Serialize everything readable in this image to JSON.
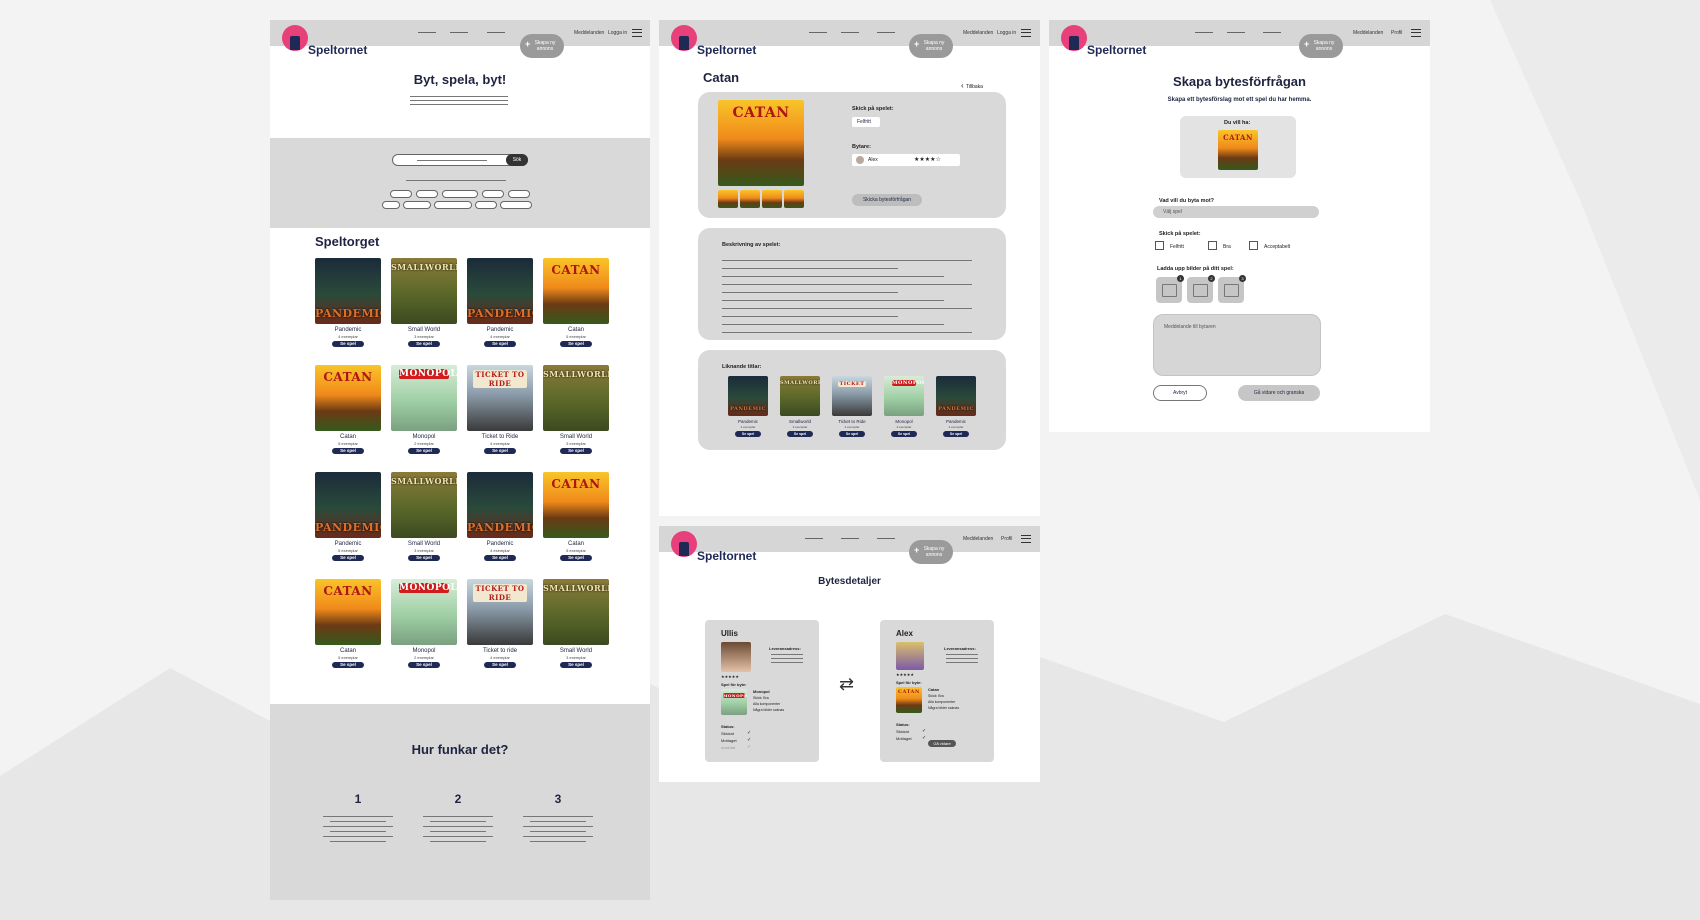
{
  "brand": "Speltornet",
  "colors": {
    "accent": "#e8407a",
    "brand_dark": "#1e2a55",
    "header_grey": "#d6d6d6",
    "panel_grey": "#d9d9d9"
  },
  "header": {
    "create_label": "Skapa ny annons",
    "messages": "Meddelanden",
    "login": "Logga in",
    "profile": "Profil",
    "menu_icon": "hamburger-icon"
  },
  "home": {
    "hero_title": "Byt, spela, byt!",
    "search_button": "Sök",
    "market_title": "Speltorget",
    "card_button": "Se spel",
    "games": [
      {
        "name": "Pandemic",
        "count": "4 exemplar",
        "cover": "pandemic",
        "cover_text": "PANDEMIC"
      },
      {
        "name": "Small World",
        "count": "3 exemplar",
        "cover": "smallworld",
        "cover_text": "SMALLWORLD"
      },
      {
        "name": "Pandemic",
        "count": "4 exemplar",
        "cover": "pandemic",
        "cover_text": "PANDEMIC"
      },
      {
        "name": "Catan",
        "count": "5 exemplar",
        "cover": "catan",
        "cover_text": "CATAN"
      },
      {
        "name": "Catan",
        "count": "5 exemplar",
        "cover": "catan",
        "cover_text": "CATAN"
      },
      {
        "name": "Monopol",
        "count": "2 exemplar",
        "cover": "monopoly",
        "cover_text": "MONOPOLY"
      },
      {
        "name": "Ticket to Ride",
        "count": "4 exemplar",
        "cover": "ticket",
        "cover_text": "TICKET TO RIDE"
      },
      {
        "name": "Small World",
        "count": "3 exemplar",
        "cover": "smallworld",
        "cover_text": "SMALLWORLD"
      },
      {
        "name": "Pandemic",
        "count": "5 exemplar",
        "cover": "pandemic",
        "cover_text": "PANDEMIC"
      },
      {
        "name": "Small World",
        "count": "3 exemplar",
        "cover": "smallworld",
        "cover_text": "SMALLWORLD"
      },
      {
        "name": "Pandemic",
        "count": "4 exemplar",
        "cover": "pandemic",
        "cover_text": "PANDEMIC"
      },
      {
        "name": "Catan",
        "count": "5 exemplar",
        "cover": "catan",
        "cover_text": "CATAN"
      },
      {
        "name": "Catan",
        "count": "5 exemplar",
        "cover": "catan",
        "cover_text": "CATAN"
      },
      {
        "name": "Monopol",
        "count": "2 exemplar",
        "cover": "monopoly",
        "cover_text": "MONOPOLY"
      },
      {
        "name": "Ticket to ride",
        "count": "4 exemplar",
        "cover": "ticket",
        "cover_text": "TICKET TO RIDE"
      },
      {
        "name": "Small World",
        "count": "3 exemplar",
        "cover": "smallworld",
        "cover_text": "SMALLWORLD"
      }
    ],
    "how_title": "Hur funkar det?",
    "steps": [
      "1",
      "2",
      "3"
    ]
  },
  "detail": {
    "title": "Catan",
    "back": "Tillbaka",
    "cover_text": "CATAN",
    "ship_label": "Skick på spelet:",
    "ship_value": "Felfritt",
    "trader_label": "Bytare:",
    "trader_name": "Alex",
    "rating": "★★★★☆",
    "send_button": "Skicka bytesförfrågan",
    "description_label": "Beskrivning av spelet:",
    "similar_label": "Liknande titlar:",
    "similar_button": "Se spel",
    "similar": [
      {
        "name": "Pandemic",
        "count": "4 exemplar",
        "cover": "pandemic",
        "cover_text": "PANDEMIC"
      },
      {
        "name": "Smallworld",
        "count": "3 exemplar",
        "cover": "smallworld",
        "cover_text": "SMALLWORLD"
      },
      {
        "name": "Ticket to Ride",
        "count": "4 exemplar",
        "cover": "ticket",
        "cover_text": "TICKET"
      },
      {
        "name": "Monopol",
        "count": "2 exemplar",
        "cover": "monopoly",
        "cover_text": "MONOPOLY"
      },
      {
        "name": "Pandemic",
        "count": "4 exemplar",
        "cover": "pandemic",
        "cover_text": "PANDEMIC"
      }
    ]
  },
  "request": {
    "title": "Skapa bytesförfrågan",
    "subtitle": "Skapa ett bytesförslag mot ett spel du har hemma.",
    "want_label": "Du vill ha:",
    "want_cover_text": "CATAN",
    "swap_label": "Vad vill du byta mot?",
    "swap_placeholder": "Välj spel",
    "condition_label": "Skick på spelet:",
    "conditions": [
      "Felfritt",
      "Bra",
      "Acceptabelt"
    ],
    "upload_label": "Ladda upp bilder på ditt spel:",
    "uploads": [
      "1",
      "2",
      "3"
    ],
    "message_placeholder": "Meddelande till bytaren",
    "cancel": "Avbryt",
    "next": "Gå vidare och granska"
  },
  "trade": {
    "title": "Bytesdetaljer",
    "left": {
      "name": "Ullis",
      "address_label": "Leveransadress:",
      "rating": "★★★★★",
      "game_label": "Spel för byte:",
      "game_name": "Monopol",
      "game_cover": "monopoly",
      "game_cover_text": "MONOPOLY",
      "game_lines": [
        "Skick: Bra",
        "Alla komponenter",
        "Några bilder saknas"
      ],
      "status_label": "Status:",
      "statuses": [
        "Skickat",
        "Mottaget",
        "Avslutat"
      ]
    },
    "right": {
      "name": "Alex",
      "address_label": "Leveransadress:",
      "rating": "★★★★★",
      "game_label": "Spel för byte:",
      "game_name": "Catan",
      "game_cover": "catan",
      "game_cover_text": "CATAN",
      "game_lines": [
        "Skick: Bra",
        "Alla komponenter",
        "Några bilder saknas"
      ],
      "status_label": "Status:",
      "statuses": [
        "Skickat",
        "Mottaget"
      ],
      "action": "Gå vidare"
    }
  }
}
